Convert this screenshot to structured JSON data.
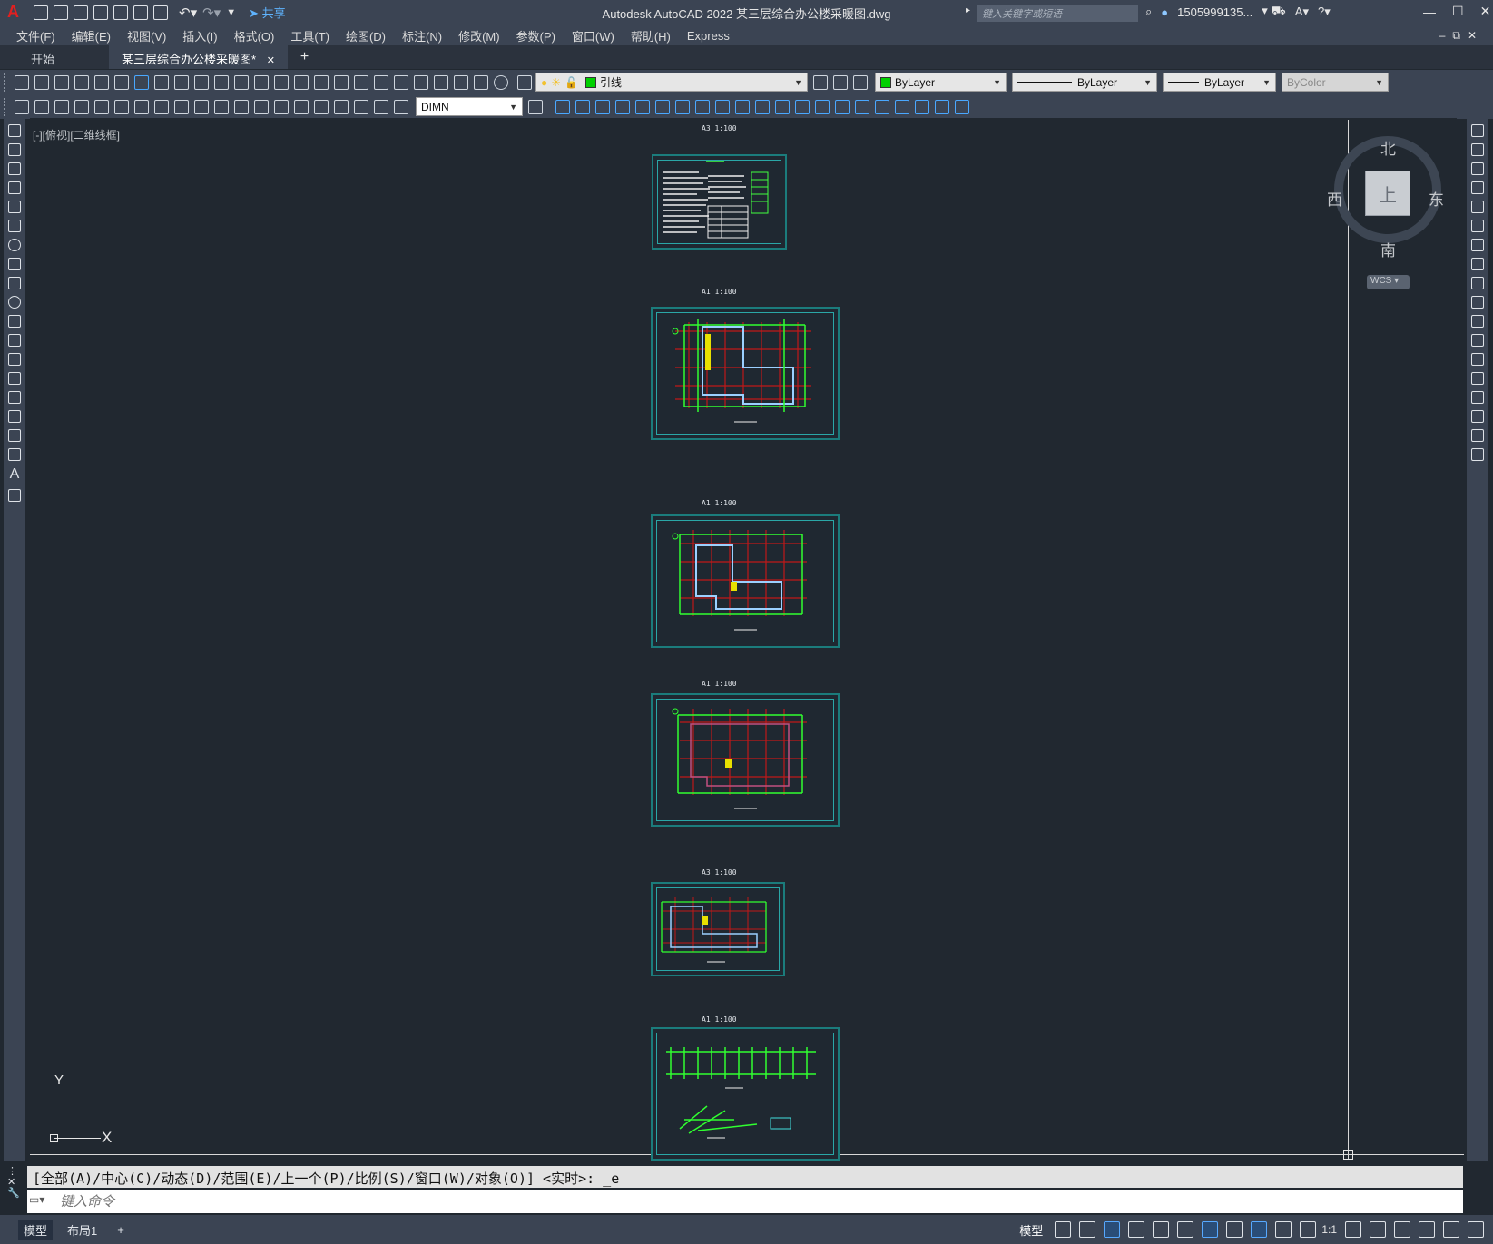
{
  "app": {
    "title": "Autodesk AutoCAD 2022    某三层综合办公楼采暖图.dwg",
    "share_label": "共享",
    "search_placeholder": "键入关键字或短语",
    "user": "1505999135...",
    "logo": "A"
  },
  "menu": [
    "文件(F)",
    "编辑(E)",
    "视图(V)",
    "插入(I)",
    "格式(O)",
    "工具(T)",
    "绘图(D)",
    "标注(N)",
    "修改(M)",
    "参数(P)",
    "窗口(W)",
    "帮助(H)",
    "Express"
  ],
  "tabs": {
    "start": "开始",
    "active": "某三层综合办公楼采暖图*",
    "close": "✕",
    "add": "+"
  },
  "toolbar": {
    "layer": "引线",
    "color": "ByLayer",
    "linetype": "ByLayer",
    "lineweight": "ByLayer",
    "plotstyle": "ByColor",
    "dimstyle": "DIMN"
  },
  "viewport": {
    "label": "[-][俯视][二维线框]",
    "sheet_captions": [
      "A3 1:100",
      "A1 1:100",
      "A1 1:100",
      "A1 1:100",
      "A3 1:100",
      "A1 1:100"
    ],
    "ucs": {
      "x": "X",
      "y": "Y"
    }
  },
  "viewcube": {
    "north": "北",
    "south": "南",
    "east": "东",
    "west": "西",
    "face": "上",
    "wcs": "WCS"
  },
  "command": {
    "history": "[全部(A)/中心(C)/动态(D)/范围(E)/上一个(P)/比例(S)/窗口(W)/对象(O)] <实时>: _e",
    "placeholder": "键入命令"
  },
  "status": {
    "model_tab": "模型",
    "layout_tab": "布局1",
    "add": "+",
    "space": "模型",
    "scale": "1:1"
  },
  "colors": {
    "background": "#212830",
    "chrome": "#3b4453",
    "layer_swatch": "#00d000"
  }
}
